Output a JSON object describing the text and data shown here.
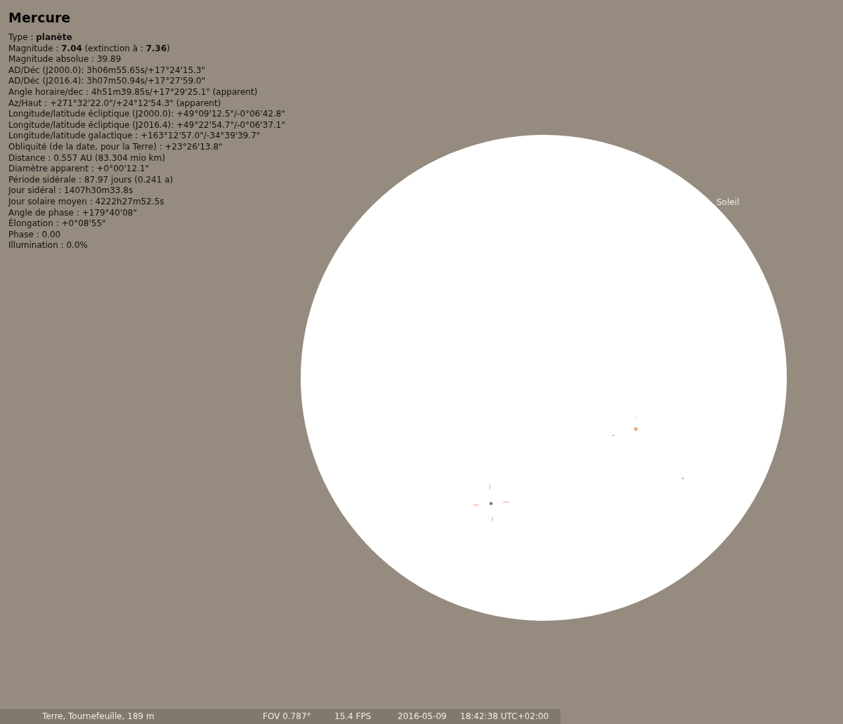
{
  "object_info": {
    "title": "Mercure",
    "lines": [
      "Type : **planète**",
      "Magnitude : **7.04** (extinction à : **7.36**)",
      "Magnitude absolue : 39.89",
      "AD/Déc (J2000.0): 3h06m55.65s/+17°24'15.3\"",
      "AD/Déc (J2016.4): 3h07m50.94s/+17°27'59.0\"",
      "Angle horaire/dec : 4h51m39.85s/+17°29'25.1\" (apparent)",
      "Az/Haut : +271°32'22.0\"/+24°12'54.3\" (apparent)",
      "Longitude/latitude écliptique (J2000.0): +49°09'12.5\"/-0°06'42.8\"",
      "Longitude/latitude écliptique (J2016.4): +49°22'54.7\"/-0°06'37.1\"",
      "Longitude/latitude galactique : +163°12'57.0\"/-34°39'39.7\"",
      "Obliquité (de la date, pour la Terre) : +23°26'13.8\"",
      "Distance : 0.557 AU (83.304 mio km)",
      "Diamètre apparent : +0°00'12.1\"",
      "Période sidérale : 87.97 jours (0.241 a)",
      "Jour sidéral : 1407h30m33.8s",
      "Jour solaire moyen : 4222h27m52.5s",
      "Angle de phase : +179°40'08\"",
      "Élongation : +0°08'55\"",
      "Phase : 0.00",
      "Illumination : 0.0%"
    ]
  },
  "sky": {
    "sun_label": "Soleil"
  },
  "status_bar": {
    "location": "Terre, Tournefeuille, 189 m",
    "fov": "FOV 0.787°",
    "fps": "15.4 FPS",
    "date": "2016-05-09",
    "time": "18:42:38 UTC+02:00"
  }
}
